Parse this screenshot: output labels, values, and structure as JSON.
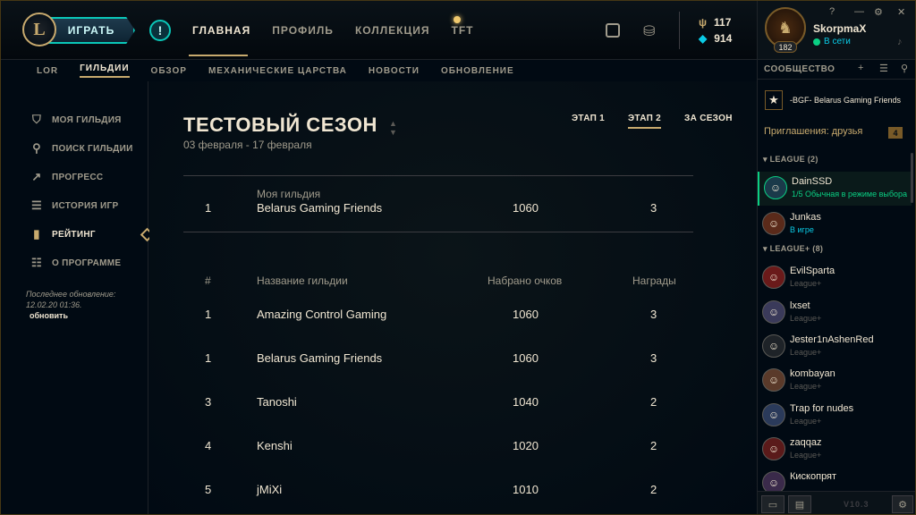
{
  "topbar": {
    "logo_text": "L",
    "play_label": "ИГРАТЬ",
    "alert_glyph": "!",
    "nav": [
      "ГЛАВНАЯ",
      "ПРОФИЛЬ",
      "КОЛЛЕКЦИЯ",
      "TFT"
    ],
    "rp": "117",
    "be": "914"
  },
  "subnav": [
    "LOR",
    "ГИЛЬДИИ",
    "ОБЗОР",
    "МЕХАНИЧЕСКИЕ ЦАРСТВА",
    "НОВОСТИ",
    "ОБНОВЛЕНИЕ"
  ],
  "sidebar": {
    "items": [
      {
        "label": "МОЯ ГИЛЬДИЯ",
        "icon": "shield-icon"
      },
      {
        "label": "ПОИСК ГИЛЬДИИ",
        "icon": "search-icon"
      },
      {
        "label": "ПРОГРЕСС",
        "icon": "trend-icon"
      },
      {
        "label": "ИСТОРИЯ ИГР",
        "icon": "list-icon"
      },
      {
        "label": "РЕЙТИНГ",
        "icon": "bar-chart-icon"
      },
      {
        "label": "О ПРОГРАММЕ",
        "icon": "scroll-icon"
      }
    ],
    "update_label": "Последнее обновление:",
    "update_time": "12.02.20 01:36.",
    "refresh": "обновить"
  },
  "main": {
    "title": "ТЕСТОВЫЙ СЕЗОН",
    "dates": "03 февраля - 17 февраля",
    "stages": [
      "ЭТАП 1",
      "ЭТАП 2",
      "ЗА СЕЗОН"
    ],
    "my_guild": {
      "rank": "1",
      "caption": "Моя гильдия",
      "name": "Belarus Gaming Friends",
      "points": "1060",
      "rewards": "3"
    },
    "headers": {
      "rank": "#",
      "name": "Название гильдии",
      "points": "Набрано очков",
      "rewards": "Награды"
    },
    "rows": [
      {
        "rank": "1",
        "name": "Amazing Control Gaming",
        "points": "1060",
        "rewards": "3"
      },
      {
        "rank": "1",
        "name": "Belarus Gaming Friends",
        "points": "1060",
        "rewards": "3"
      },
      {
        "rank": "3",
        "name": "Tanoshi",
        "points": "1040",
        "rewards": "2"
      },
      {
        "rank": "4",
        "name": "Kenshi",
        "points": "1020",
        "rewards": "2"
      },
      {
        "rank": "5",
        "name": "jMiXi",
        "points": "1010",
        "rewards": "2"
      }
    ]
  },
  "social": {
    "name": "SkorpmaX",
    "status": "В сети",
    "level": "182",
    "community": "СООБЩЕСТВО",
    "clan": "-BGF- Belarus Gaming Friends",
    "invites": "Приглашения: друзья",
    "invites_count": "4",
    "group1": "LEAGUE (2)",
    "group2": "LEAGUE+ (8)",
    "friends": [
      {
        "name": "DainSSD",
        "status": "1/5 Обычная в режиме выбора",
        "kind": "green"
      },
      {
        "name": "Junkas",
        "status": "В игре",
        "kind": "blue"
      },
      {
        "name": "EvilSparta",
        "status": "League+",
        "kind": "grey"
      },
      {
        "name": "lxset",
        "status": "League+",
        "kind": "grey"
      },
      {
        "name": "Jester1nAshenRed",
        "status": "League+",
        "kind": "grey"
      },
      {
        "name": "kombayan",
        "status": "League+",
        "kind": "grey"
      },
      {
        "name": "Trap for nudes",
        "status": "League+",
        "kind": "grey"
      },
      {
        "name": "zaqqaz",
        "status": "League+",
        "kind": "grey"
      },
      {
        "name": "Кископрят",
        "status": "",
        "kind": "grey"
      }
    ],
    "version": "V10.3"
  },
  "colors": {
    "gold": "#c8aa6e",
    "teal": "#0ac8b9",
    "bg": "#010a13",
    "online": "#0acf83"
  }
}
